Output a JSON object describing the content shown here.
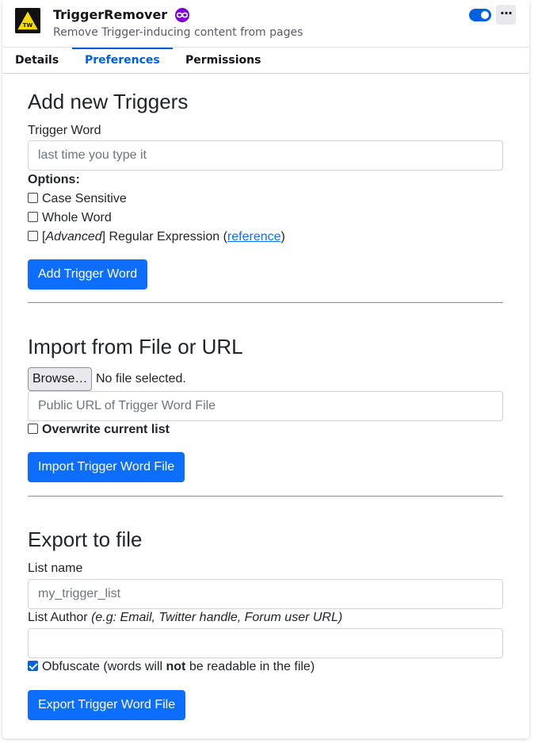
{
  "header": {
    "extension_name": "TriggerRemover",
    "description": "Remove Trigger-inducing content from pages",
    "logo_text": "TW",
    "private_icon": "private-browsing-icon",
    "enabled": true,
    "more_label": "···"
  },
  "tabs": [
    {
      "label": "Details",
      "active": false
    },
    {
      "label": "Preferences",
      "active": true
    },
    {
      "label": "Permissions",
      "active": false
    }
  ],
  "add_section": {
    "title": "Add new Triggers",
    "trigger_word_label": "Trigger Word",
    "trigger_word_placeholder": "last time you type it",
    "options_label": "Options:",
    "case_sensitive_label": "Case Sensitive",
    "whole_word_label": "Whole Word",
    "regex_prefix": "[",
    "regex_advanced": "Advanced",
    "regex_middle": "] Regular Expression (",
    "regex_link": "reference",
    "regex_suffix": ")",
    "button_label": "Add Trigger Word"
  },
  "import_section": {
    "title": "Import from File or URL",
    "browse_label": "Browse…",
    "file_status": "No file selected.",
    "url_placeholder": "Public URL of Trigger Word File",
    "overwrite_label": "Overwrite current list",
    "button_label": "Import Trigger Word File"
  },
  "export_section": {
    "title": "Export to file",
    "list_name_label": "List name",
    "list_name_placeholder": "my_trigger_list",
    "list_author_label": "List Author",
    "list_author_hint": "(e.g: Email, Twitter handle, Forum user URL)",
    "list_author_value": "",
    "obfuscate_prefix": "Obfuscate (words will ",
    "obfuscate_bold": "not",
    "obfuscate_suffix": " be readable in the file)",
    "obfuscate_checked": true,
    "button_label": "Export Trigger Word File"
  },
  "colors": {
    "accent": "#0061e0",
    "button": "#0d6efd",
    "private_purple": "#8000d7",
    "logo_yellow": "#f5d90a"
  }
}
